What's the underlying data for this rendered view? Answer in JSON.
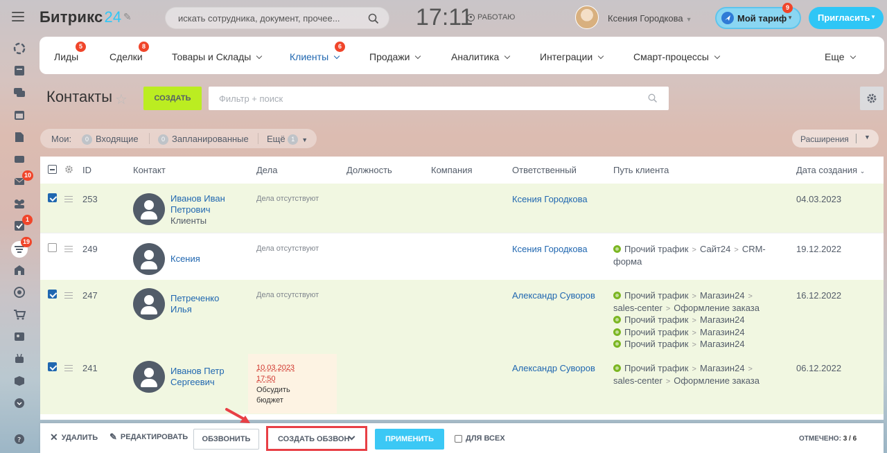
{
  "header": {
    "logo_text": "Битрикс",
    "logo_num": "24",
    "search_placeholder": "искать сотрудника, документ, прочее...",
    "time": "17:11",
    "work_status": "РАБОТАЮ",
    "user_name": "Ксения Городкова",
    "tariff_label": "Мой тариф",
    "tariff_badge": "9",
    "invite_label": "Пригласить"
  },
  "sidebar": {
    "badges": {
      "mail": "10",
      "tasks": "1",
      "crm": "19"
    }
  },
  "nav": {
    "tabs": [
      {
        "label": "Лиды",
        "badge": "5"
      },
      {
        "label": "Сделки",
        "badge": "8"
      },
      {
        "label": "Товары и Склады"
      },
      {
        "label": "Клиенты",
        "badge": "6",
        "active": true
      },
      {
        "label": "Продажи"
      },
      {
        "label": "Аналитика"
      },
      {
        "label": "Интеграции"
      },
      {
        "label": "Смарт-процессы"
      },
      {
        "label": "Еще"
      }
    ]
  },
  "page": {
    "title": "Контакты",
    "create_label": "СОЗДАТЬ",
    "filter_placeholder": "Фильтр + поиск"
  },
  "counters": {
    "my_label": "Мои:",
    "incoming_count": "0",
    "incoming_label": "Входящие",
    "planned_count": "0",
    "planned_label": "Запланированные",
    "more_label": "Ещё",
    "more_count": "1",
    "extensions_label": "Расширения"
  },
  "table": {
    "headers": {
      "id": "ID",
      "contact": "Контакт",
      "deals": "Дела",
      "position": "Должность",
      "company": "Компания",
      "responsible": "Ответственный",
      "path": "Путь клиента",
      "created": "Дата создания"
    },
    "rows": [
      {
        "id": "253",
        "name_l1": "Иванов Иван",
        "name_l2": "Петрович",
        "sub": "Клиенты",
        "deals": "Дела отсутствуют",
        "responsible": "Ксения Городкова",
        "date": "04.03.2023",
        "checked": true
      },
      {
        "id": "249",
        "name_l1": "Ксения",
        "deals": "Дела отсутствуют",
        "responsible": "Ксения Городкова",
        "path_a": "Прочий трафик",
        "path_b": "Сайт24",
        "path_c": "CRM-",
        "path_d": "форма",
        "date": "19.12.2022",
        "checked": false
      },
      {
        "id": "247",
        "name_l1": "Петреченко",
        "name_l2": "Илья",
        "deals": "Дела отсутствуют",
        "responsible": "Александр Суворов",
        "path_a": "Прочий трафик",
        "path_b": "Магазин24",
        "path_c": "sales-center",
        "path_d": "Оформление заказа",
        "path_e": "Прочий трафик",
        "path_f": "Магазин24",
        "date": "16.12.2022",
        "checked": true
      },
      {
        "id": "241",
        "name_l1": "Иванов Петр",
        "name_l2": "Сергеевич",
        "act_date": "10.03.2023",
        "act_time": "17:50",
        "act_text_l1": "Обсудить",
        "act_text_l2": "бюджет",
        "responsible": "Александр Суворов",
        "path_a": "Прочий трафик",
        "path_b": "Магазин24",
        "path_c": "sales-center",
        "path_d": "Оформление заказа",
        "date": "06.12.2022",
        "checked": true
      }
    ]
  },
  "bottom": {
    "delete_label": "УДАЛИТЬ",
    "edit_label": "РЕДАКТИРОВАТЬ",
    "call_label": "ОБЗВОНИТЬ",
    "create_call_label": "СОЗДАТЬ ОБЗВОН",
    "apply_label": "ПРИМЕНИТЬ",
    "for_all_label": "ДЛЯ ВСЕХ",
    "marked_label": "ОТМЕЧЕНО:",
    "marked_value": "3 / 6"
  },
  "colors": {
    "accent": "#2fc6f6",
    "link": "#2067b0",
    "create_btn": "#bbed21",
    "highlight": "#e83f45"
  }
}
